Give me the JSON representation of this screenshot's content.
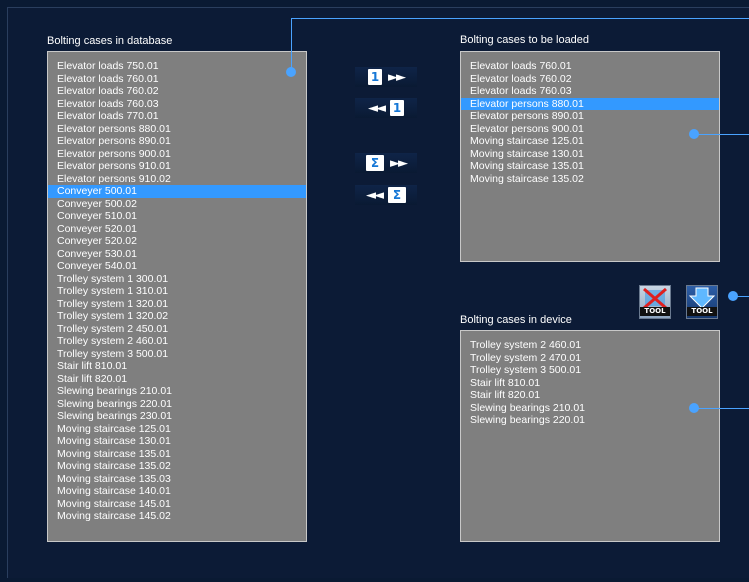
{
  "labels": {
    "database": "Bolting cases in database",
    "to_be_loaded": "Bolting cases to be loaded",
    "device": "Bolting cases in device"
  },
  "database_list": [
    "Elevator loads 750.01",
    "Elevator loads 760.01",
    "Elevator loads 760.02",
    "Elevator loads 760.03",
    "Elevator loads 770.01",
    "Elevator persons 880.01",
    "Elevator persons 890.01",
    "Elevator persons 900.01",
    "Elevator persons 910.01",
    "Elevator persons 910.02",
    "Conveyer 500.01",
    "Conveyer 500.02",
    "Conveyer 510.01",
    "Conveyer 520.01",
    "Conveyer 520.02",
    "Conveyer 530.01",
    "Conveyer 540.01",
    "Trolley system 1 300.01",
    "Trolley system 1 310.01",
    "Trolley system 1 320.01",
    "Trolley system 1 320.02",
    "Trolley system 2 450.01",
    "Trolley system 2 460.01",
    "Trolley system 3 500.01",
    "Stair lift 810.01",
    "Stair lift 820.01",
    "Slewing bearings 210.01",
    "Slewing bearings 220.01",
    "Slewing bearings 230.01",
    "Moving staircase 125.01",
    "Moving staircase 130.01",
    "Moving staircase 135.01",
    "Moving staircase 135.02",
    "Moving staircase 135.03",
    "Moving staircase 140.01",
    "Moving staircase 145.01",
    "Moving staircase 145.02"
  ],
  "database_selected_index": 10,
  "load_list": [
    "Elevator loads 760.01",
    "Elevator loads 760.02",
    "Elevator loads 760.03",
    "Elevator persons 880.01",
    "Elevator persons 890.01",
    "Elevator persons 900.01",
    "Moving staircase 125.01",
    "Moving staircase 130.01",
    "Moving staircase 135.01",
    "Moving staircase 135.02"
  ],
  "load_selected_index": 3,
  "device_list": [
    "Trolley system 2 460.01",
    "Trolley system 2 470.01",
    "Trolley system 3 500.01",
    "Stair lift 810.01",
    "Stair lift 820.01",
    "Slewing bearings 210.01",
    "Slewing bearings 220.01"
  ],
  "buttons": {
    "add_one_digit": "1",
    "remove_one_digit": "1",
    "add_all_symbol": "Σ",
    "remove_all_symbol": "Σ",
    "forward_arrows": "►►",
    "back_arrows": "◄◄"
  },
  "tools": {
    "delete_tool_tag": "TOOL",
    "download_tool_tag": "TOOL"
  },
  "colors": {
    "selection": "#3399ff",
    "accent": "#4aa3ff",
    "list_bg": "#7f7f7f"
  }
}
